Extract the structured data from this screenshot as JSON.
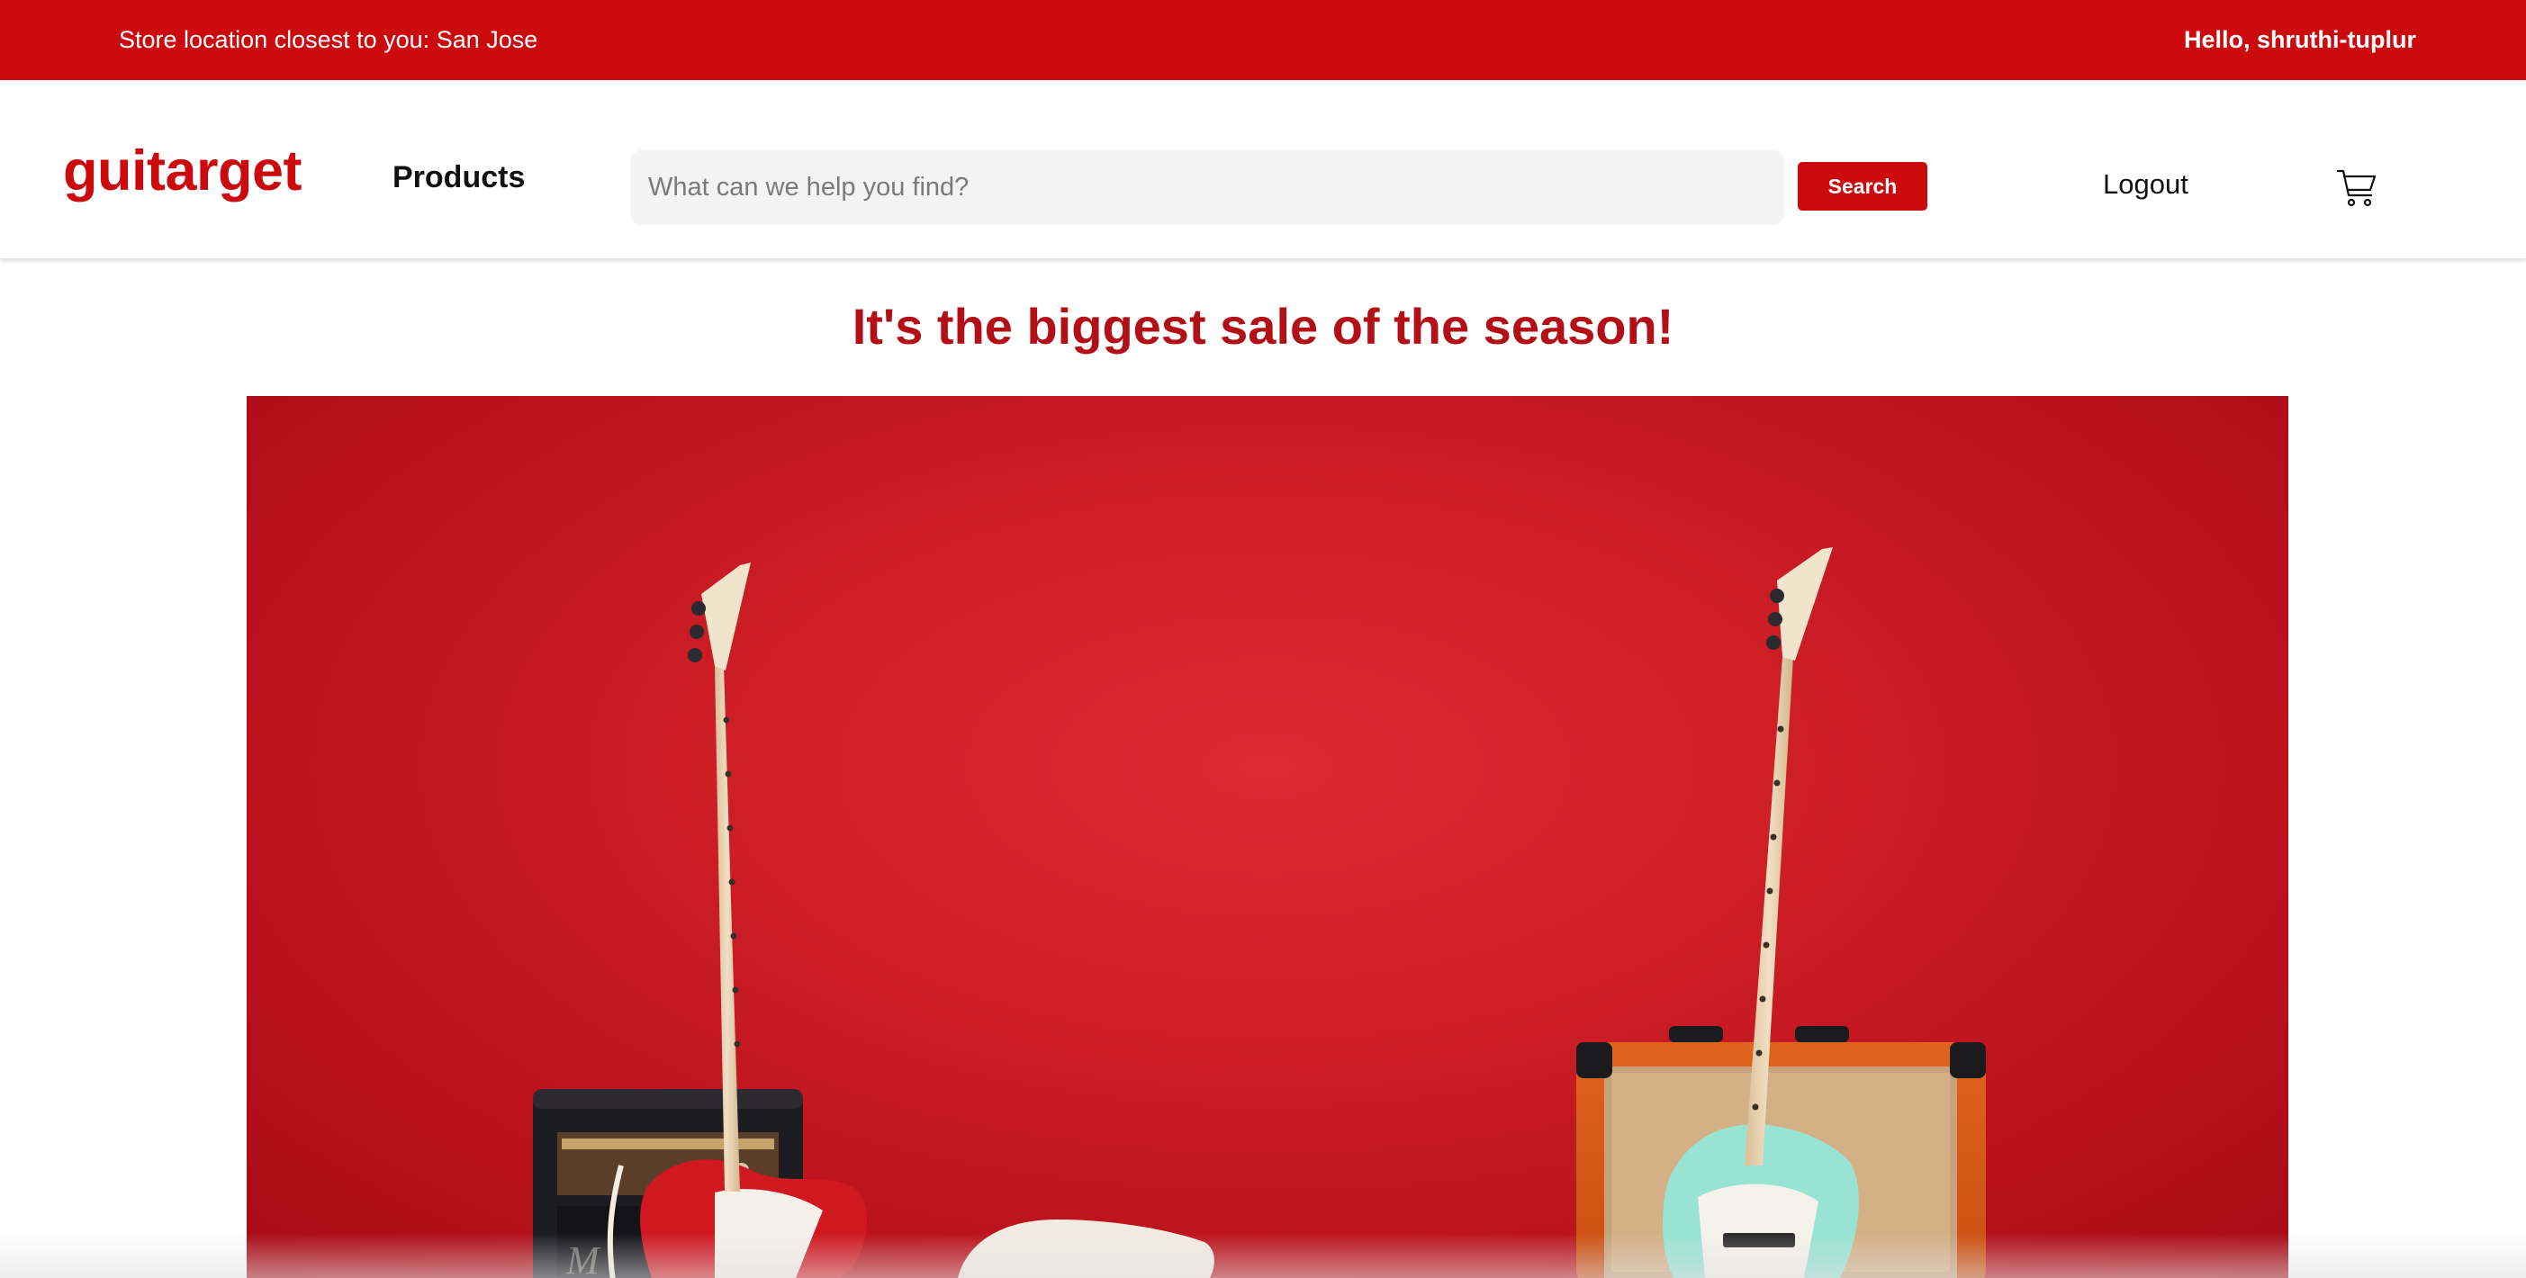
{
  "topbar": {
    "store_location": "Store location closest to you: San Jose",
    "greeting": "Hello, shruthi-tuplur"
  },
  "header": {
    "logo": "guitarget",
    "nav_products": "Products",
    "search": {
      "placeholder": "What can we help you find?",
      "value": "",
      "button_label": "Search"
    },
    "logout_label": "Logout",
    "cart_icon": "shopping-cart-icon"
  },
  "main": {
    "headline": "It's the biggest sale of the season!",
    "hero_image": "hero-guitars-image"
  },
  "colors": {
    "brand_red": "#cc0a0e",
    "headline_red": "#b30f17",
    "search_bg": "#f4f4f4"
  }
}
